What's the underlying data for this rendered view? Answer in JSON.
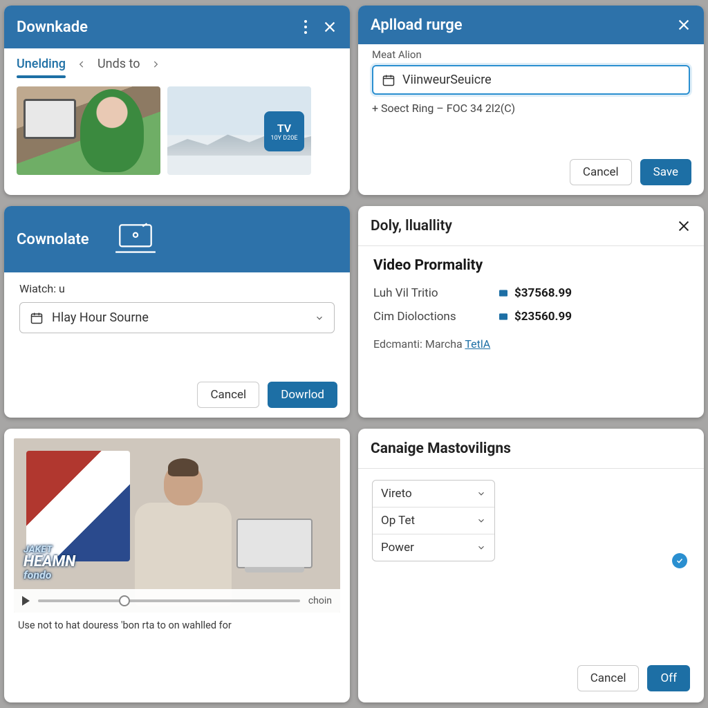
{
  "p1": {
    "title": "Downkade",
    "tab_active": "Unelding",
    "tab_inactive": "Unds to",
    "tv_badge_top": "TV",
    "tv_badge_small": "10Y D20E"
  },
  "p2": {
    "title": "Aplload rurge",
    "field_label": "Meat Alion",
    "input_value": "ViinweurSeuicre",
    "hint": "+ Soect Ring – FOC 34 2l2(C)",
    "cancel": "Cancel",
    "save": "Save"
  },
  "p3": {
    "title": "Cownolate",
    "field_label": "Wiatch: u",
    "select_value": "Hlay Hour Sourne",
    "cancel": "Cancel",
    "download": "Dowrlod"
  },
  "p4": {
    "title": "Doly, lluallity",
    "subtitle": "Video Prormality",
    "rows": [
      {
        "k": "Luh Vil Tritio",
        "v": "$37568.99"
      },
      {
        "k": "Cim Dioloctions",
        "v": "$23560.99"
      }
    ],
    "link_prefix": "Edcmanti: Marcha ",
    "link_text": "TetlA"
  },
  "p5": {
    "lower3_l1": "JAKET",
    "lower3_l2": "HEAMN",
    "lower3_l3": "fondo",
    "time_label": "choin",
    "caption": "Use not to hat douress 'bon rta to on wahlled for"
  },
  "p6": {
    "title": "Canaige Mastoviligns",
    "options": [
      "Vireto",
      "Op Tet",
      "Power"
    ],
    "cancel": "Cancel",
    "off": "Off"
  }
}
